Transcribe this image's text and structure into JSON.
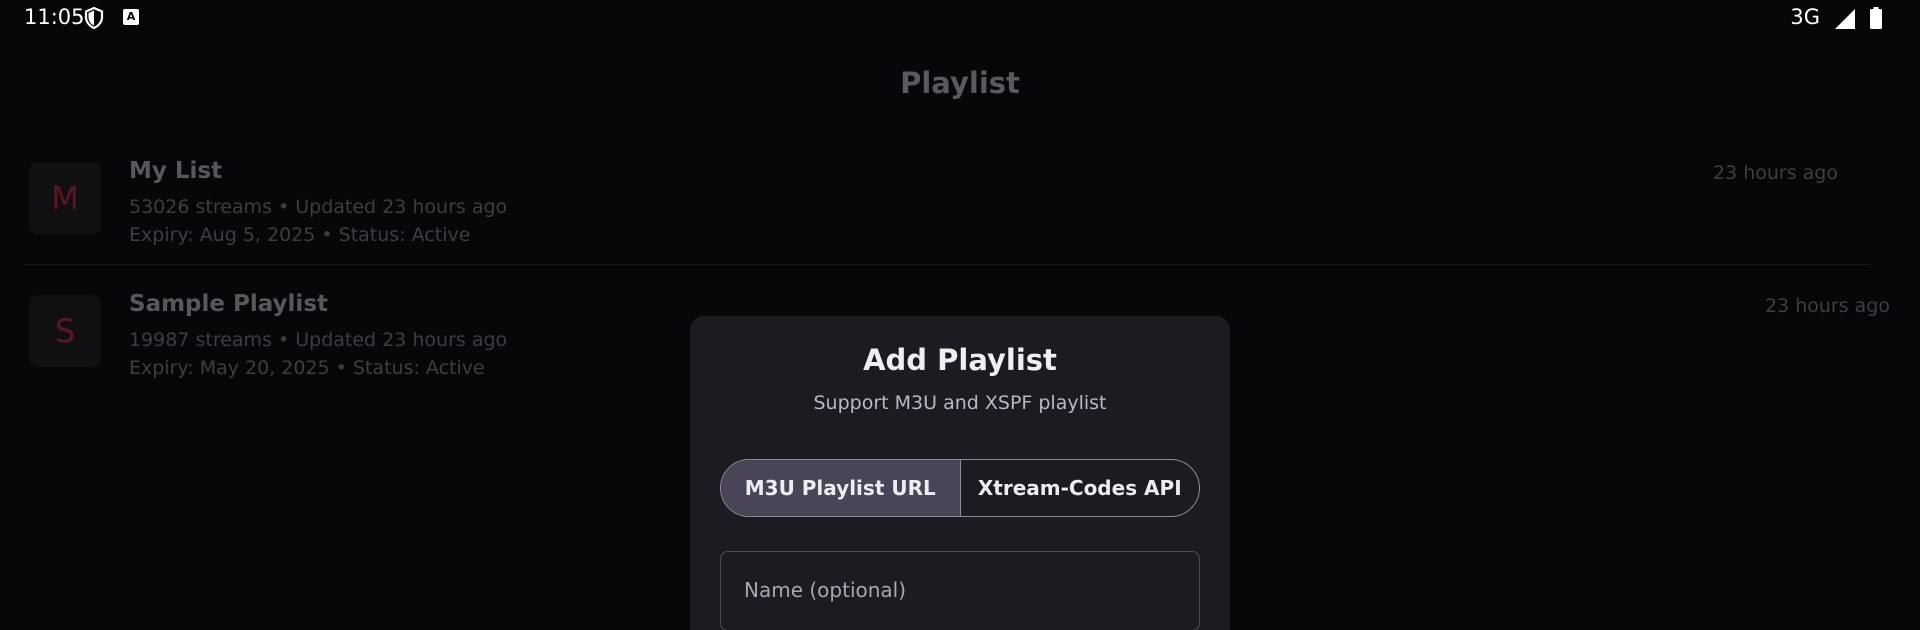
{
  "status_bar": {
    "time": "11:05",
    "app_icon_letter": "A",
    "network": "3G",
    "icons": [
      "shield-icon",
      "app-notification-icon",
      "signal-icon",
      "battery-icon"
    ]
  },
  "page": {
    "title": "Playlist"
  },
  "playlists": [
    {
      "avatar_letter": "M",
      "name": "My List",
      "streams_line": "53026 streams  •  Updated 23 hours ago",
      "expiry_line": "Expiry: Aug 5, 2025  •  Status: Active",
      "time": "23 hours ago"
    },
    {
      "avatar_letter": "S",
      "name": "Sample Playlist",
      "streams_line": "19987 streams  •  Updated 23 hours ago",
      "expiry_line": "Expiry: May 20, 2025  •  Status: Active",
      "time": "23 hours ago"
    }
  ],
  "dialog": {
    "title": "Add Playlist",
    "subtitle": "Support M3U and XSPF playlist",
    "tabs": [
      {
        "label": "M3U Playlist URL",
        "selected": true
      },
      {
        "label": "Xtream-Codes API",
        "selected": false
      }
    ],
    "name_field": {
      "placeholder": "Name (optional)",
      "value": ""
    }
  },
  "colors": {
    "background": "#07070a",
    "dialog_background": "#1b1b22",
    "selected_tab": "#4a4457",
    "avatar_letter": "#5e1620"
  }
}
